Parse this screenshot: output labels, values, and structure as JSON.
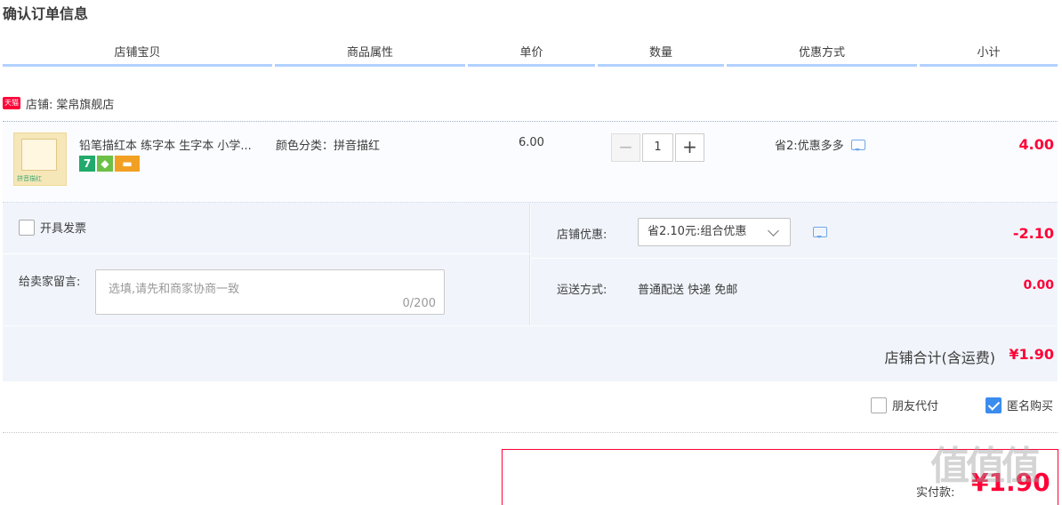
{
  "page_title": "确认订单信息",
  "columns": [
    "店铺宝贝",
    "商品属性",
    "单价",
    "数量",
    "优惠方式",
    "小计"
  ],
  "shop": {
    "badge": "天猫",
    "label": "店铺:",
    "name": "棠帛旗舰店"
  },
  "item": {
    "title": "铅笔描红本 练字本 生字本 小学...",
    "thumb_text": "拼音描红",
    "badges": [
      "7",
      "",
      ""
    ],
    "attribute": "颜色分类：拼音描红",
    "price": "6.00",
    "quantity": "1",
    "minus": "−",
    "plus": "+",
    "promo": "省2:优惠多多",
    "subtotal": "4.00"
  },
  "invoice": {
    "label": "开具发票"
  },
  "message": {
    "label": "给卖家留言:",
    "placeholder": "选填,请先和商家协商一致",
    "count": "0/200"
  },
  "shop_discount": {
    "label": "店铺优惠:",
    "selected": "省2.10元:组合优惠",
    "amount": "-2.10"
  },
  "shipping": {
    "label": "运送方式:",
    "value": "普通配送 快递 免邮",
    "amount": "0.00"
  },
  "shop_total": {
    "label": "店铺合计(含运费)",
    "amount": "¥1.90"
  },
  "options": {
    "friend_pay": "朋友代付",
    "anonymous": "匿名购买",
    "anonymous_checked": true
  },
  "payment": {
    "label": "实付款:",
    "amount": "¥1.90"
  },
  "watermark": "值值值",
  "colors": {
    "accent": "#ff0036",
    "header_line": "#b2d1ff",
    "panel_bg": "#f1f5fb",
    "checkbox_checked": "#3b8cef"
  }
}
